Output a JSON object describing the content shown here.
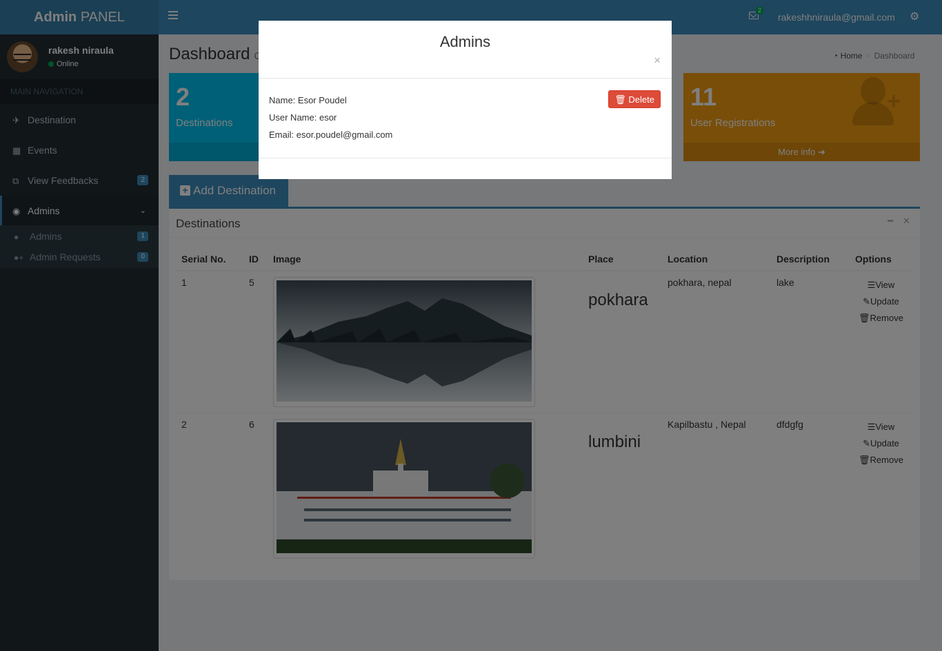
{
  "brand": {
    "bold": "Admin",
    "rest": " PANEL"
  },
  "header": {
    "mail_count": "2",
    "user_email": "rakeshhniraula@gmail.com"
  },
  "user": {
    "name": "rakesh niraula",
    "status": "Online"
  },
  "sidebar": {
    "section_label": "MAIN NAVIGATION",
    "items": [
      {
        "label": "Destination",
        "icon": "plane-icon"
      },
      {
        "label": "Events",
        "icon": "calendar-icon"
      },
      {
        "label": "View Feedbacks",
        "icon": "clone-icon",
        "badge": "2"
      },
      {
        "label": "Admins",
        "icon": "user-circle-icon"
      }
    ],
    "sub_items": [
      {
        "label": "Admins",
        "icon": "user-icon",
        "badge": "1"
      },
      {
        "label": "Admin Requests",
        "icon": "user-plus-icon",
        "badge": "0"
      }
    ]
  },
  "page": {
    "title": "Dashboard",
    "subtitle": "Co",
    "breadcrumb_home": "Home",
    "breadcrumb_current": "Dashboard"
  },
  "stats": {
    "destinations": {
      "value": "2",
      "label": "Destinations"
    },
    "registrations": {
      "value": "11",
      "label": "User Registrations",
      "footer": "More info"
    }
  },
  "add_destination_label": "Add Destination",
  "destinations_panel": {
    "title": "Destinations",
    "columns": [
      "Serial No.",
      "ID",
      "Image",
      "Place",
      "Location",
      "Description",
      "Options"
    ],
    "rows": [
      {
        "serial": "1",
        "id": "5",
        "place": "pokhara",
        "location": "pokhara, nepal",
        "description": "lake"
      },
      {
        "serial": "2",
        "id": "6",
        "place": "lumbini",
        "location": "Kapilbastu , Nepal",
        "description": "dfdgfg"
      }
    ],
    "options": {
      "view": "View",
      "update": "Update",
      "remove": "Remove"
    }
  },
  "modal": {
    "title": "Admins",
    "name": "Name: Esor Poudel",
    "username": "User Name: esor",
    "email": "Email: esor.poudel@gmail.com",
    "delete_label": "Delete"
  },
  "colors": {
    "header": "#3c8dbc",
    "logo_bg": "#367fa9",
    "sidebar": "#222d32",
    "aqua": "#00c0ef",
    "yellow": "#f39c12",
    "danger": "#dd4b39"
  }
}
